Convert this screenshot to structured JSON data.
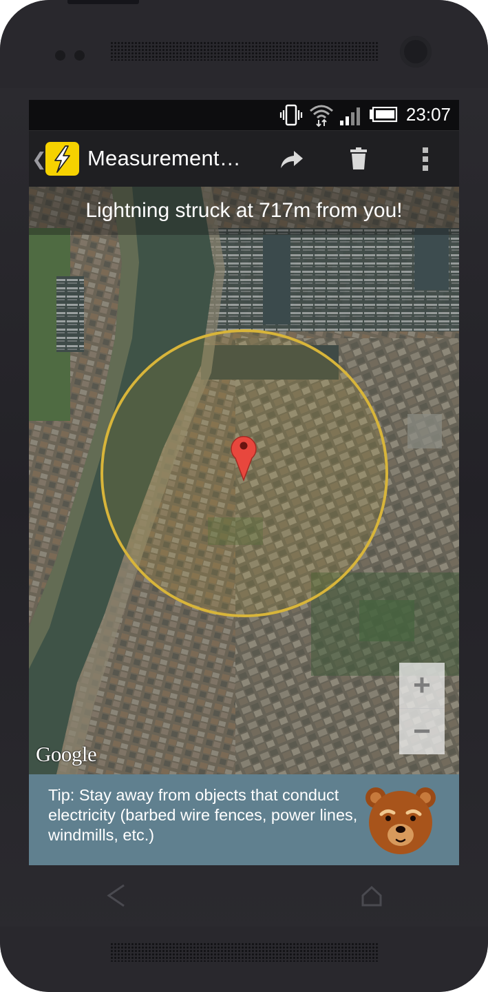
{
  "status_bar": {
    "time": "23:07",
    "icons": [
      "vibrate-icon",
      "wifi-icon",
      "signal-icon",
      "battery-icon"
    ]
  },
  "action_bar": {
    "title": "Measurement…",
    "app_icon": "lightning-icon",
    "actions": [
      "share-icon",
      "delete-icon",
      "overflow-menu-icon"
    ]
  },
  "map": {
    "banner": "Lightning struck at 717m from you!",
    "attribution": "Google",
    "zoom_in": "+",
    "zoom_out": "−",
    "marker_icon": "map-pin-icon",
    "radius_circle_color": "#d8b53a"
  },
  "tip": {
    "text": "Tip: Stay away from objects that conduct electricity (barbed wire fences, power lines, windmills, etc.)",
    "mascot": "bear-icon"
  },
  "colors": {
    "tip_background": "#60808f",
    "app_icon_background": "#f6d200",
    "action_bar": "#1f1f22"
  }
}
